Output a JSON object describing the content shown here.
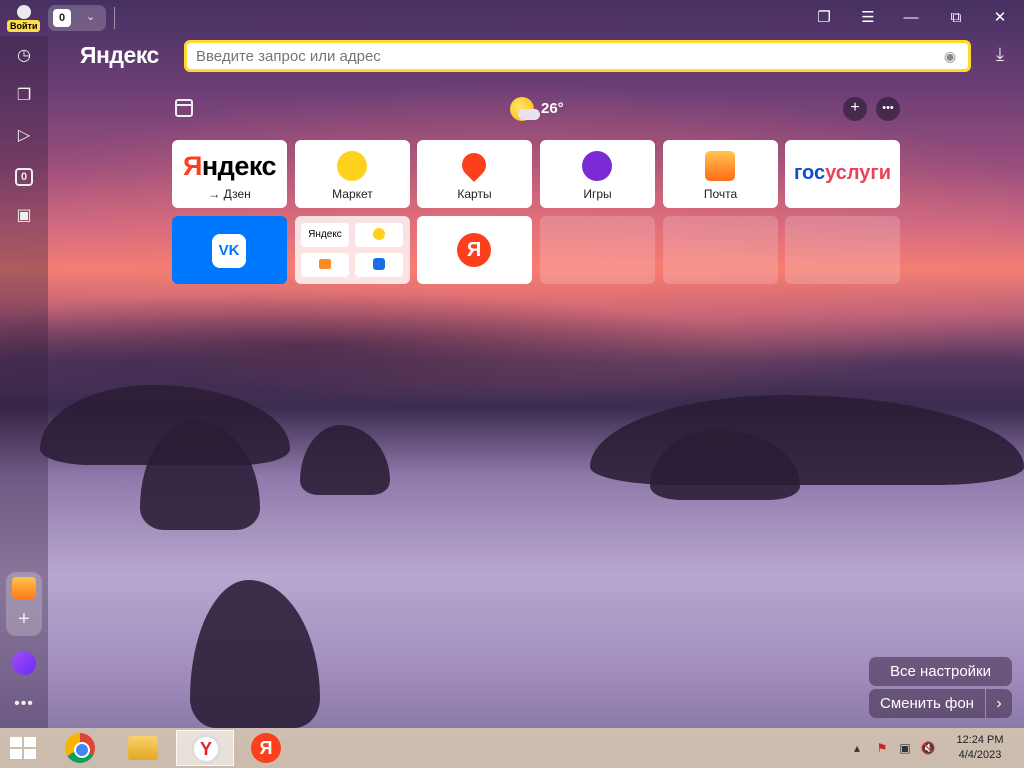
{
  "titlebar": {
    "login_label": "Войти",
    "tab_count": "0"
  },
  "brand": {
    "logo": "Яндекс"
  },
  "search": {
    "placeholder": "Введите запрос или адрес",
    "value": ""
  },
  "sidebar": {
    "counter": "0"
  },
  "weather": {
    "temperature": "26°"
  },
  "tiles": [
    {
      "logo_red": "Я",
      "logo_rest": "ндекс",
      "label": "→ Дзен"
    },
    {
      "label": "Маркет"
    },
    {
      "label": "Карты"
    },
    {
      "label": "Игры"
    },
    {
      "label": "Почта"
    },
    {
      "logo_a": "гос",
      "logo_b": "услуги"
    }
  ],
  "tiles_row2": {
    "vk_label": "VK",
    "folder_mini_1": "Яндекс",
    "ya_letter": "Я"
  },
  "actions": {
    "all_settings": "Все настройки",
    "change_background": "Сменить фон"
  },
  "taskbar": {
    "time": "12:24 PM",
    "date": "4/4/2023",
    "yb_letter": "Y",
    "ya_letter": "Я"
  },
  "colors": {
    "search_border": "#ffd92f",
    "yandex_red": "#fc3f1d",
    "vk_blue": "#0077ff"
  }
}
